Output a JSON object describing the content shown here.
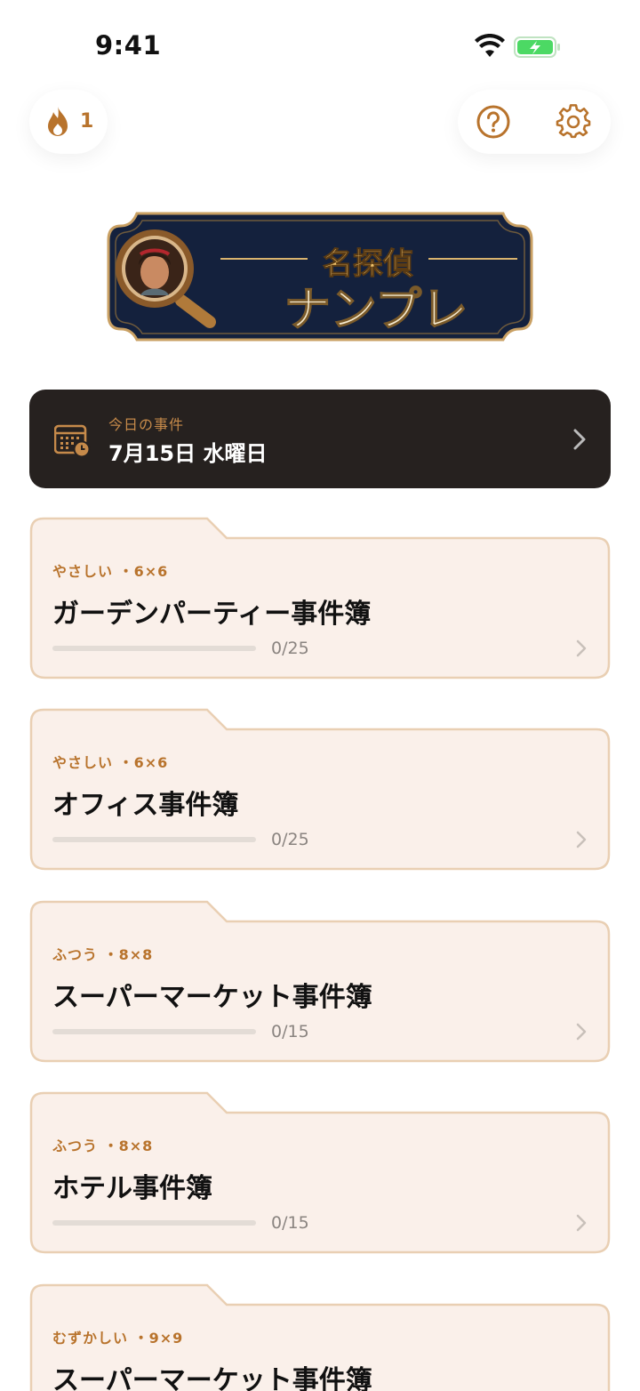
{
  "status_bar": {
    "time": "9:41"
  },
  "header": {
    "streak_count": "1",
    "icons": {
      "streak": "flame-icon",
      "help": "help-circle-icon",
      "settings": "gear-icon"
    }
  },
  "logo": {
    "title_top": "名探偵",
    "title_main": "ナンプレ"
  },
  "today": {
    "label": "今日の事件",
    "date": "7月15日 水曜日"
  },
  "casebooks": [
    {
      "level": "やさしい",
      "size": "・6×6",
      "title": "ガーデンパーティー事件簿",
      "progress": "0/25",
      "progress_fraction": 0
    },
    {
      "level": "やさしい",
      "size": "・6×6",
      "title": "オフィス事件簿",
      "progress": "0/25",
      "progress_fraction": 0
    },
    {
      "level": "ふつう",
      "size": "・8×8",
      "title": "スーパーマーケット事件簿",
      "progress": "0/15",
      "progress_fraction": 0
    },
    {
      "level": "ふつう",
      "size": "・8×8",
      "title": "ホテル事件簿",
      "progress": "0/15",
      "progress_fraction": 0
    },
    {
      "level": "むずかしい",
      "size": "・9×9",
      "title": "スーパーマーケット事件簿",
      "progress": "",
      "progress_fraction": 0
    }
  ],
  "colors": {
    "accent": "#B8732C",
    "dark_card": "#26211f",
    "card_bg": "#FAF0EA",
    "card_border": "#E9CFB3",
    "logo_navy": "#14213D",
    "logo_gold": "#F2C46D"
  }
}
